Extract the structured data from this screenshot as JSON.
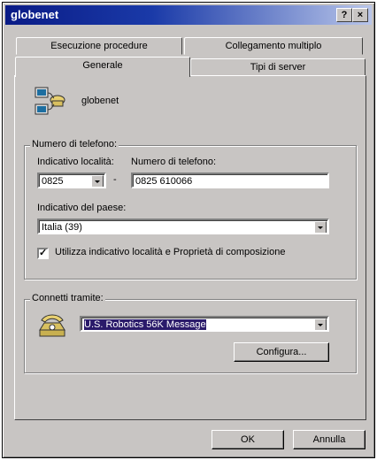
{
  "window": {
    "title": "globenet",
    "help_label": "?",
    "close_label": "×"
  },
  "tabs": {
    "row_back": [
      "Esecuzione procedure",
      "Collegamento multiplo"
    ],
    "row_front": [
      "Generale",
      "Tipi di server"
    ],
    "active": "Generale"
  },
  "connection": {
    "name": "globenet"
  },
  "phone_group": {
    "legend": "Numero di telefono:",
    "area_code_label": "Indicativo località:",
    "area_code_value": "0825",
    "separator": "-",
    "phone_label": "Numero di telefono:",
    "phone_value": "0825 610066",
    "country_label": "Indicativo del paese:",
    "country_value": "Italia (39)",
    "use_area_checkbox_label": "Utilizza indicativo località e Proprietà di composizione",
    "use_area_checked": true,
    "check_mark": "✓"
  },
  "connect_group": {
    "legend": "Connetti tramite:",
    "modem_value": "U.S. Robotics 56K Message",
    "configure_label": "Configura..."
  },
  "footer": {
    "ok_label": "OK",
    "cancel_label": "Annulla"
  }
}
